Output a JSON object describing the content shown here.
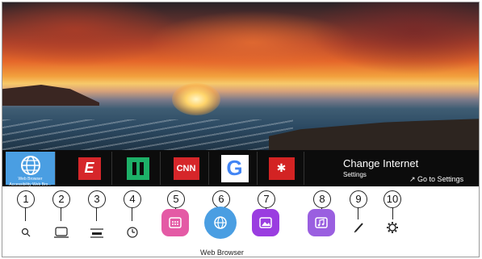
{
  "launcher": {
    "selected_label": "Web Browser",
    "selected_sublabel": "Accessibility Web Bro...",
    "apps": [
      {
        "name": "espn",
        "text": "E"
      },
      {
        "name": "hulu",
        "text": ""
      },
      {
        "name": "cnn",
        "text": "CNN"
      },
      {
        "name": "google",
        "text": "G"
      },
      {
        "name": "yelp",
        "text": "✱"
      }
    ],
    "info_title": "Change Internet",
    "info_sub": "Settings",
    "go_settings": "Go to Settings"
  },
  "callouts": [
    "1",
    "2",
    "3",
    "4",
    "5",
    "6",
    "7",
    "8",
    "9",
    "10"
  ],
  "icons": [
    "search-icon",
    "input-icon",
    "settings-icon",
    "timer-icon",
    "apps-icon",
    "globe-icon",
    "photo-icon",
    "music-icon",
    "pencil-icon",
    "gear-icon"
  ],
  "bottom_label": "Web Browser",
  "colors": {
    "browser": "#4a9ee2",
    "apps_pink": "#e45aa5",
    "photos": "#9a3de0",
    "music": "#9a5fe0"
  }
}
